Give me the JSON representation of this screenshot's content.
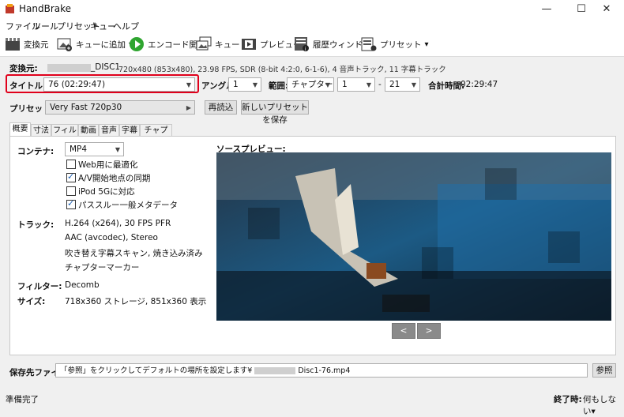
{
  "window": {
    "title": "HandBrake",
    "min": "—",
    "max": "☐",
    "close": "✕"
  },
  "menu": [
    "ファイル",
    "ツール",
    "プリセット",
    "キュー",
    "ヘルプ"
  ],
  "toolbar": {
    "source": "変換元",
    "add_queue": "キューに追加",
    "start": "エンコード開始",
    "queue": "キュー",
    "preview": "プレビュー",
    "activity": "履歴ウィンドウ",
    "presets": "プリセット"
  },
  "source": {
    "label": "変換元:",
    "name": "_DISC1",
    "info": "720x480 (853x480), 23.98 FPS, SDR (8-bit 4:2:0, 6-1-6), 4 音声トラック, 11 字幕トラック"
  },
  "title_row": {
    "title_label": "タイトル:",
    "title_value": "76  (02:29:47)",
    "angle_label": "アングル:",
    "angle_value": "1",
    "range_label": "範囲:",
    "range_type": "チャプター",
    "range_start": "1",
    "range_sep": "-",
    "range_end": "21",
    "duration_label": "合計時間:",
    "duration_value": "02:29:47"
  },
  "preset_row": {
    "label": "プリセット:",
    "value": "Very Fast 720p30",
    "reload": "再読込",
    "save_new": "新しいプリセットを保存"
  },
  "tabs": [
    "概要",
    "寸法",
    "フィルタ",
    "動画",
    "音声",
    "字幕",
    "チャプター"
  ],
  "summary": {
    "container_label": "コンテナ:",
    "container_value": "MP4",
    "options": [
      {
        "label": "Web用に最適化",
        "checked": false
      },
      {
        "label": "A/V開始地点の同期",
        "checked": true
      },
      {
        "label": "iPod 5Gに対応",
        "checked": false
      },
      {
        "label": "パススルー一般メタデータ",
        "checked": true
      }
    ],
    "tracks_label": "トラック:",
    "tracks": [
      "H.264 (x264), 30 FPS PFR",
      "AAC (avcodec), Stereo",
      "吹き替え字幕スキャン, 焼き込み済み",
      "チャプターマーカー"
    ],
    "filters_label": "フィルター:",
    "filters_value": "Decomb",
    "size_label": "サイズ:",
    "size_value": "718x360 ストレージ, 851x360 表示",
    "preview_label": "ソースプレビュー:",
    "prev": "<",
    "next": ">"
  },
  "destination": {
    "label": "保存先ファイル:",
    "value": "「参照」をクリックしてデフォルトの場所を設定します¥",
    "value_tail": "Disc1-76.mp4",
    "browse": "参照"
  },
  "status": {
    "text": "準備完了",
    "when_done_label": "終了時:",
    "when_done_value": "何もしない▾"
  },
  "colors": {
    "highlight": "#e0001b",
    "start_green": "#2fa530"
  }
}
